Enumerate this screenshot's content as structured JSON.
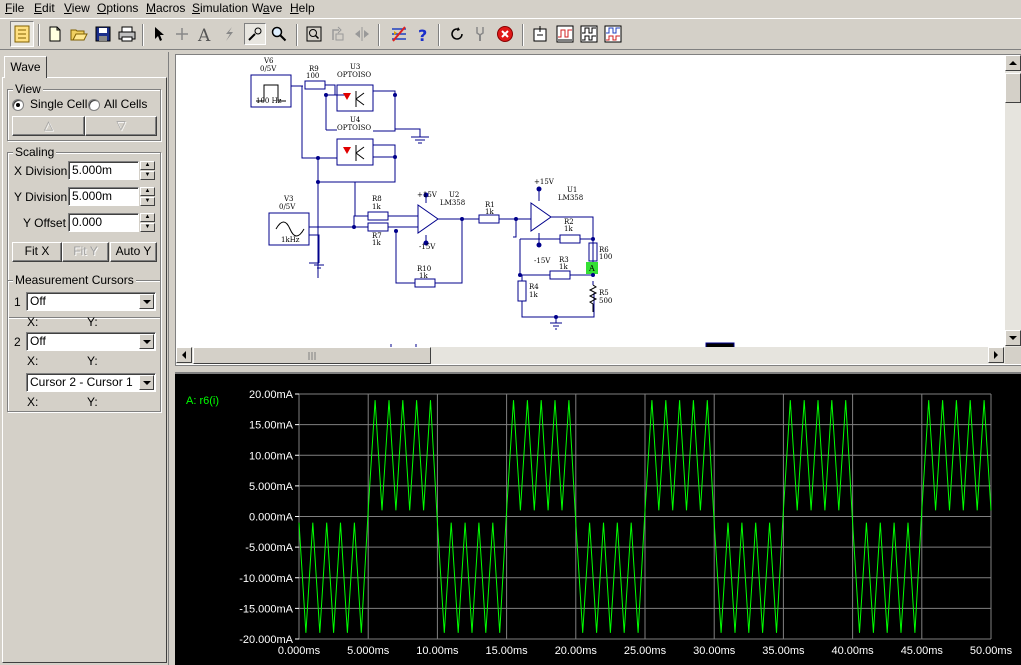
{
  "menu": [
    "File",
    "Edit",
    "View",
    "Options",
    "Macros",
    "Simulation",
    "Wave",
    "Help"
  ],
  "menu_underline": [
    "F",
    "E",
    "V",
    "O",
    "M",
    "S",
    "a",
    "H"
  ],
  "toolbar_icons": [
    "schematic-mode-icon",
    "new-icon",
    "open-icon",
    "save-icon",
    "print-icon",
    "pointer-icon",
    "crosshair-icon",
    "text-icon",
    "wire-icon",
    "probe-icon",
    "zoom-icon",
    "zoom-fit-icon",
    "rotate-icon",
    "flip-icon",
    "netlist-icon",
    "help-icon",
    "undo-icon",
    "tools-icon",
    "stop-icon",
    "component-icon",
    "waveform-icon",
    "waveform2-icon",
    "waveform3-icon"
  ],
  "tab": "Wave",
  "view": {
    "title": "View",
    "single_cell": "Single Cell",
    "all_cells": "All Cells",
    "up": "△",
    "down": "▽"
  },
  "scaling": {
    "title": "Scaling",
    "x_div_label": "X Division",
    "x_div_value": "5.000m",
    "y_div_label": "Y Division",
    "y_div_value": "5.000m",
    "y_off_label": "Y Offset",
    "y_off_value": "0.000",
    "fit_x": "Fit X",
    "fit_y": "Fit Y",
    "auto_y": "Auto Y"
  },
  "cursors": {
    "title": "Measurement Cursors",
    "row1_num": "1",
    "row1_value": "Off",
    "row2_num": "2",
    "row2_value": "Off",
    "row3_value": "Cursor 2 - Cursor 1",
    "x_label": "X:",
    "y_label": "Y:"
  },
  "schematic": {
    "v6_name": "V6",
    "v6_val": "0/5V",
    "v6_freq": "100 Hz",
    "r9_name": "R9",
    "r9_val": "100",
    "u3_name": "U3",
    "u3_part": "OPTOISO",
    "u4_name": "U4",
    "u4_part": "OPTOISO",
    "v3_name": "V3",
    "v3_val": "0/5V",
    "v3_freq": "1kHz",
    "r8_name": "R8",
    "r8_val": "1k",
    "r7_name": "R7",
    "r7_val": "1k",
    "u2_name": "U2",
    "u2_part": "LM358",
    "u2_vp": "+15V",
    "u2_vn": "-15V",
    "r1_name": "R1",
    "r1_val": "1k",
    "r10_name": "R10",
    "r10_val": "1k",
    "u1_name": "U1",
    "u1_part": "LM358",
    "u1_vp": "+15V",
    "u1_vn": "-15V",
    "r2_name": "R2",
    "r2_val": "1k",
    "r3_name": "R3",
    "r3_val": "1k",
    "r6_name": "R6",
    "r6_val": "100",
    "r4_name": "R4",
    "r4_val": "1k",
    "r5_name": "R5",
    "r5_val": "500",
    "probe_label": "A"
  },
  "chart_data": {
    "type": "line",
    "trace_label": "A: r6(i)",
    "xlim": [
      0,
      50
    ],
    "ylim": [
      -20,
      20
    ],
    "x_ticks": [
      "0.000ms",
      "5.000ms",
      "10.00ms",
      "15.00ms",
      "20.00ms",
      "25.00ms",
      "30.00ms",
      "35.00ms",
      "40.00ms",
      "45.00ms",
      "50.00ms"
    ],
    "y_ticks": [
      "20.00mA",
      "15.00mA",
      "10.00mA",
      "5.000mA",
      "0.000mA",
      "-5.000mA",
      "-10.000mA",
      "-15.000mA",
      "-20.000mA"
    ],
    "series": [
      {
        "name": "A: r6(i)",
        "color": "#00ff00",
        "gate_period_ms": 10,
        "carrier_period_ms": 1,
        "high_window_mA": [
          0,
          20
        ],
        "low_window_mA": [
          -20,
          0
        ],
        "points": [
          [
            0,
            -1
          ],
          [
            0.5,
            -19
          ],
          [
            1,
            -1
          ],
          [
            1.5,
            -19
          ],
          [
            2,
            -1
          ],
          [
            2.5,
            -19
          ],
          [
            3,
            -1
          ],
          [
            3.5,
            -19
          ],
          [
            4,
            -1
          ],
          [
            4.5,
            -19
          ],
          [
            5,
            1
          ],
          [
            5.5,
            19
          ],
          [
            6,
            1
          ],
          [
            6.5,
            19
          ],
          [
            7,
            1
          ],
          [
            7.5,
            19
          ],
          [
            8,
            1
          ],
          [
            8.5,
            19
          ],
          [
            9,
            1
          ],
          [
            9.5,
            19
          ],
          [
            10,
            -1
          ],
          [
            10.5,
            -19
          ],
          [
            11,
            -1
          ],
          [
            11.5,
            -19
          ],
          [
            12,
            -1
          ],
          [
            12.5,
            -19
          ],
          [
            13,
            -1
          ],
          [
            13.5,
            -19
          ],
          [
            14,
            -1
          ],
          [
            14.5,
            -19
          ],
          [
            15,
            1
          ],
          [
            15.5,
            19
          ],
          [
            16,
            1
          ],
          [
            16.5,
            19
          ],
          [
            17,
            1
          ],
          [
            17.5,
            19
          ],
          [
            18,
            1
          ],
          [
            18.5,
            19
          ],
          [
            19,
            1
          ],
          [
            19.5,
            19
          ],
          [
            20,
            -1
          ],
          [
            20.5,
            -19
          ],
          [
            21,
            -1
          ],
          [
            21.5,
            -19
          ],
          [
            22,
            -1
          ],
          [
            22.5,
            -19
          ],
          [
            23,
            -1
          ],
          [
            23.5,
            -19
          ],
          [
            24,
            -1
          ],
          [
            24.5,
            -19
          ],
          [
            25,
            1
          ],
          [
            25.5,
            19
          ],
          [
            26,
            1
          ],
          [
            26.5,
            19
          ],
          [
            27,
            1
          ],
          [
            27.5,
            19
          ],
          [
            28,
            1
          ],
          [
            28.5,
            19
          ],
          [
            29,
            1
          ],
          [
            29.5,
            19
          ],
          [
            30,
            -1
          ],
          [
            30.5,
            -19
          ],
          [
            31,
            -1
          ],
          [
            31.5,
            -19
          ],
          [
            32,
            -1
          ],
          [
            32.5,
            -19
          ],
          [
            33,
            -1
          ],
          [
            33.5,
            -19
          ],
          [
            34,
            -1
          ],
          [
            34.5,
            -19
          ],
          [
            35,
            1
          ],
          [
            35.5,
            19
          ],
          [
            36,
            1
          ],
          [
            36.5,
            19
          ],
          [
            37,
            1
          ],
          [
            37.5,
            19
          ],
          [
            38,
            1
          ],
          [
            38.5,
            19
          ],
          [
            39,
            1
          ],
          [
            39.5,
            19
          ],
          [
            40,
            -1
          ],
          [
            40.5,
            -19
          ],
          [
            41,
            -1
          ],
          [
            41.5,
            -19
          ],
          [
            42,
            -1
          ],
          [
            42.5,
            -19
          ],
          [
            43,
            -1
          ],
          [
            43.5,
            -19
          ],
          [
            44,
            -1
          ],
          [
            44.5,
            -19
          ],
          [
            45,
            1
          ],
          [
            45.5,
            19
          ],
          [
            46,
            1
          ],
          [
            46.5,
            19
          ],
          [
            47,
            1
          ],
          [
            47.5,
            19
          ],
          [
            48,
            1
          ],
          [
            48.5,
            19
          ],
          [
            49,
            1
          ],
          [
            49.5,
            19
          ],
          [
            50,
            1
          ]
        ]
      }
    ],
    "grid": true,
    "background": "#000000",
    "grid_color": "#808080"
  }
}
